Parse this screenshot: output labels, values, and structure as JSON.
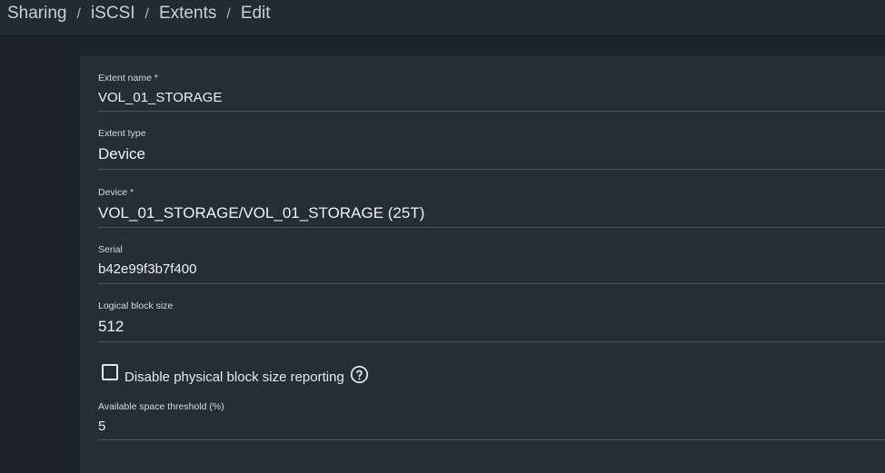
{
  "breadcrumb": {
    "items": [
      "Sharing",
      "iSCSI",
      "Extents",
      "Edit"
    ],
    "separator": "/"
  },
  "form": {
    "extent_name": {
      "label": "Extent name *",
      "value": "VOL_01_STORAGE"
    },
    "extent_type": {
      "label": "Extent type",
      "value": "Device"
    },
    "device": {
      "label": "Device *",
      "value": "VOL_01_STORAGE/VOL_01_STORAGE (25T)"
    },
    "serial": {
      "label": "Serial",
      "value": "b42e99f3b7f400"
    },
    "logical_block_size": {
      "label": "Logical block size",
      "value": "512"
    },
    "disable_physical_block": {
      "label": "Disable physical block size reporting",
      "checked": false,
      "help_icon": "help-circle-icon"
    },
    "space_threshold": {
      "label": "Available space threshold (%)",
      "value": "5"
    }
  },
  "colors": {
    "page_bg": "#1d232a",
    "card_bg": "#252d35",
    "topbar_bg": "#222a32",
    "text": "#e6e9ec",
    "divider": "#4b545c"
  }
}
